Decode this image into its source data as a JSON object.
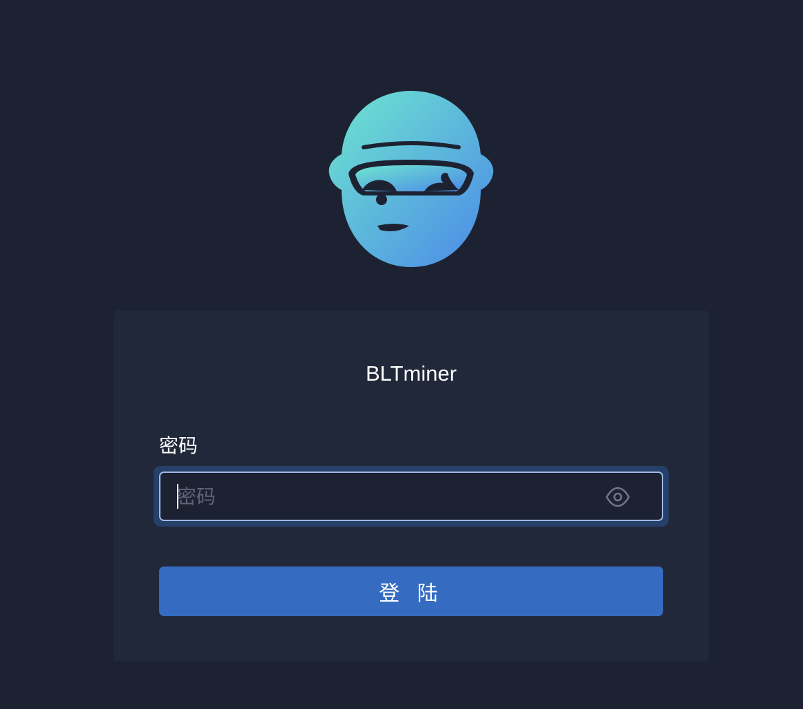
{
  "app": {
    "name": "BLTminer",
    "logo_icon": "miner-mascot-logo-icon"
  },
  "login_form": {
    "password_label": "密码",
    "password_value": "",
    "password_placeholder": "密码",
    "visibility_toggle_icon": "eye-icon",
    "submit_label": "登 陆"
  },
  "colors": {
    "background": "#1d2232",
    "card": "#21283a",
    "accent": "#356bc1",
    "input_focus_border": "#9fb9e6",
    "logo_gradient_start": "#6ee6cf",
    "logo_gradient_end": "#4b88e8"
  }
}
